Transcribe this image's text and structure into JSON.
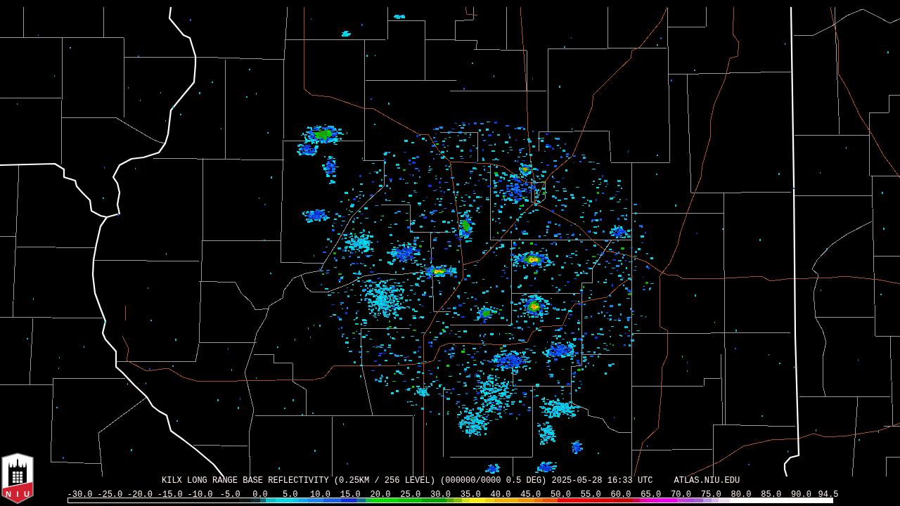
{
  "logo": {
    "text": "NIU"
  },
  "product_line": {
    "title": "KILX LONG RANGE BASE REFLECTIVITY (0.25KM / 256 LEVEL) (000000/0000 0.5 DEG) 2025-05-28 16:33 UTC",
    "source": "ATLAS.NIU.EDU"
  },
  "color_scale": {
    "labels": [
      "-30.0",
      "-25.0",
      "-20.0",
      "-15.0",
      "-10.0",
      "-5.0",
      "0.0",
      "5.0",
      "10.0",
      "15.0",
      "20.0",
      "25.0",
      "30.0",
      "35.0",
      "40.0",
      "45.0",
      "50.0",
      "55.0",
      "60.0",
      "65.0",
      "70.0",
      "75.0",
      "80.0",
      "85.0",
      "90.0",
      "94.5"
    ]
  }
}
